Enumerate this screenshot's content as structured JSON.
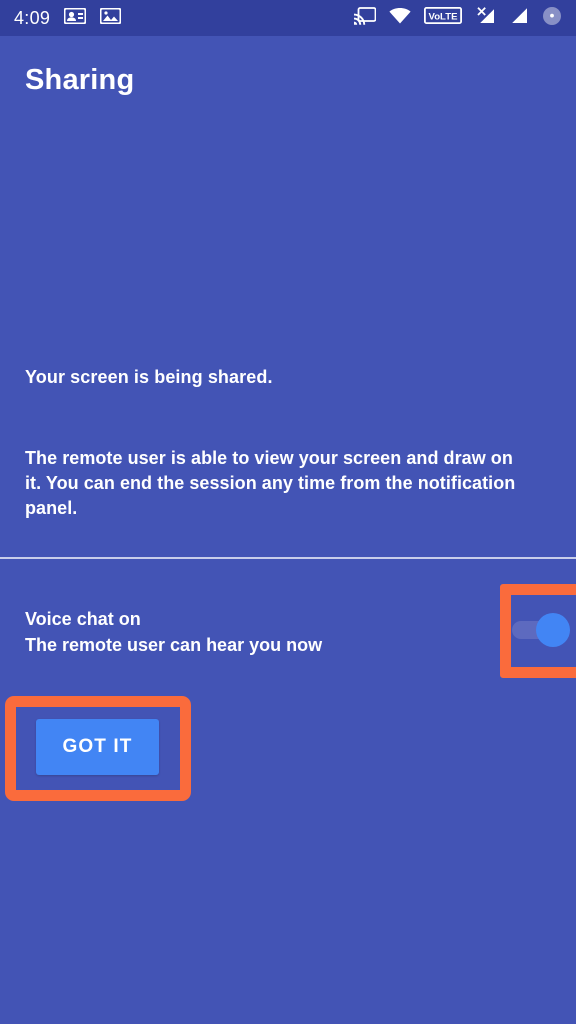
{
  "status_bar": {
    "time": "4:09",
    "left_icons": [
      {
        "name": "contact-card-icon",
        "glyph": "contact-card"
      },
      {
        "name": "image-icon",
        "glyph": "image"
      }
    ],
    "right_icons": [
      {
        "name": "cast-icon",
        "glyph": "cast"
      },
      {
        "name": "wifi-icon",
        "glyph": "wifi"
      },
      {
        "name": "volte-icon",
        "label": "VoLTE"
      },
      {
        "name": "signal-no-service-icon",
        "glyph": "signal-x"
      },
      {
        "name": "signal-bars-icon",
        "glyph": "signal"
      },
      {
        "name": "battery-icon",
        "glyph": "battery"
      }
    ]
  },
  "header": {
    "title": "Sharing"
  },
  "main": {
    "headline": "Your screen is being shared.",
    "body": "The remote user is able to view your screen and draw on it. You can end the session any time from the notification panel."
  },
  "voice_chat": {
    "title": "Voice chat on",
    "subtitle": "The remote user can hear you now",
    "toggle_state": "on"
  },
  "actions": {
    "got_it_label": "GOT IT"
  },
  "colors": {
    "background": "#4354B5",
    "status_bar": "#32409D",
    "accent_blue": "#4285F4",
    "highlight_orange": "#FA6B3C",
    "toggle_track": "#5D6ABF",
    "divider": "#C9CEEA",
    "text": "#FFFFFF"
  }
}
